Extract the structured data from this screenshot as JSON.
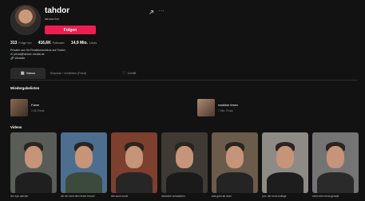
{
  "profile": {
    "username": "tahdor",
    "display_name": "tahdor.live",
    "follow_label": "Folgen",
    "stats": [
      {
        "value": "313",
        "label": "Folge ich"
      },
      {
        "value": "416,6K",
        "label": "Follower"
      },
      {
        "value": "14,9 Mio.",
        "label": "Likes"
      }
    ],
    "bio": [
      "Privater acc für Reaktionsvideos auf Twitch",
      "✉ privat@tahdor-media.de",
      "🔗 Website"
    ]
  },
  "tabs": [
    {
      "label": "Videos",
      "icon": "grid-icon",
      "active": true
    },
    {
      "label": "Reposts / Vorlieben (Feed)",
      "icon": "",
      "active": false
    },
    {
      "label": "Gefällt",
      "icon": "heart-icon",
      "active": false
    }
  ],
  "playlists": {
    "title": "Wiedergabelisten",
    "items": [
      {
        "name": "Fame",
        "count": "1,5K Posts"
      },
      {
        "name": "reaktion lesen",
        "count": "7 Mio. Posts"
      }
    ]
  },
  "videos": {
    "title": "Videos",
    "items": [
      {
        "caption": "live eye-catcher",
        "bg": "#5a5c58",
        "body": "#1f1f1f"
      },
      {
        "caption": "ich bin nicht dein lieber freund",
        "bg": "#4d6e8f",
        "body": "#3b4a3a"
      },
      {
        "caption": "wie auch sonst",
        "bg": "#7d3f2e",
        "body": "#262626"
      },
      {
        "caption": "deutsche schwächen",
        "bg": "#3f3a34",
        "body": "#1a1a1a"
      },
      {
        "caption": "was geht ab leute",
        "bg": "#6b5b4a",
        "body": "#242424"
      },
      {
        "caption": "pov: der neue kollege",
        "bg": "#8e8a86",
        "body": "#1d1d1d"
      },
      {
        "caption": "nicht mein ernst gerade",
        "bg": "#747474",
        "body": "#2a2a2a"
      }
    ]
  },
  "colors": {
    "accent": "#ee1d52",
    "background": "#121212"
  }
}
